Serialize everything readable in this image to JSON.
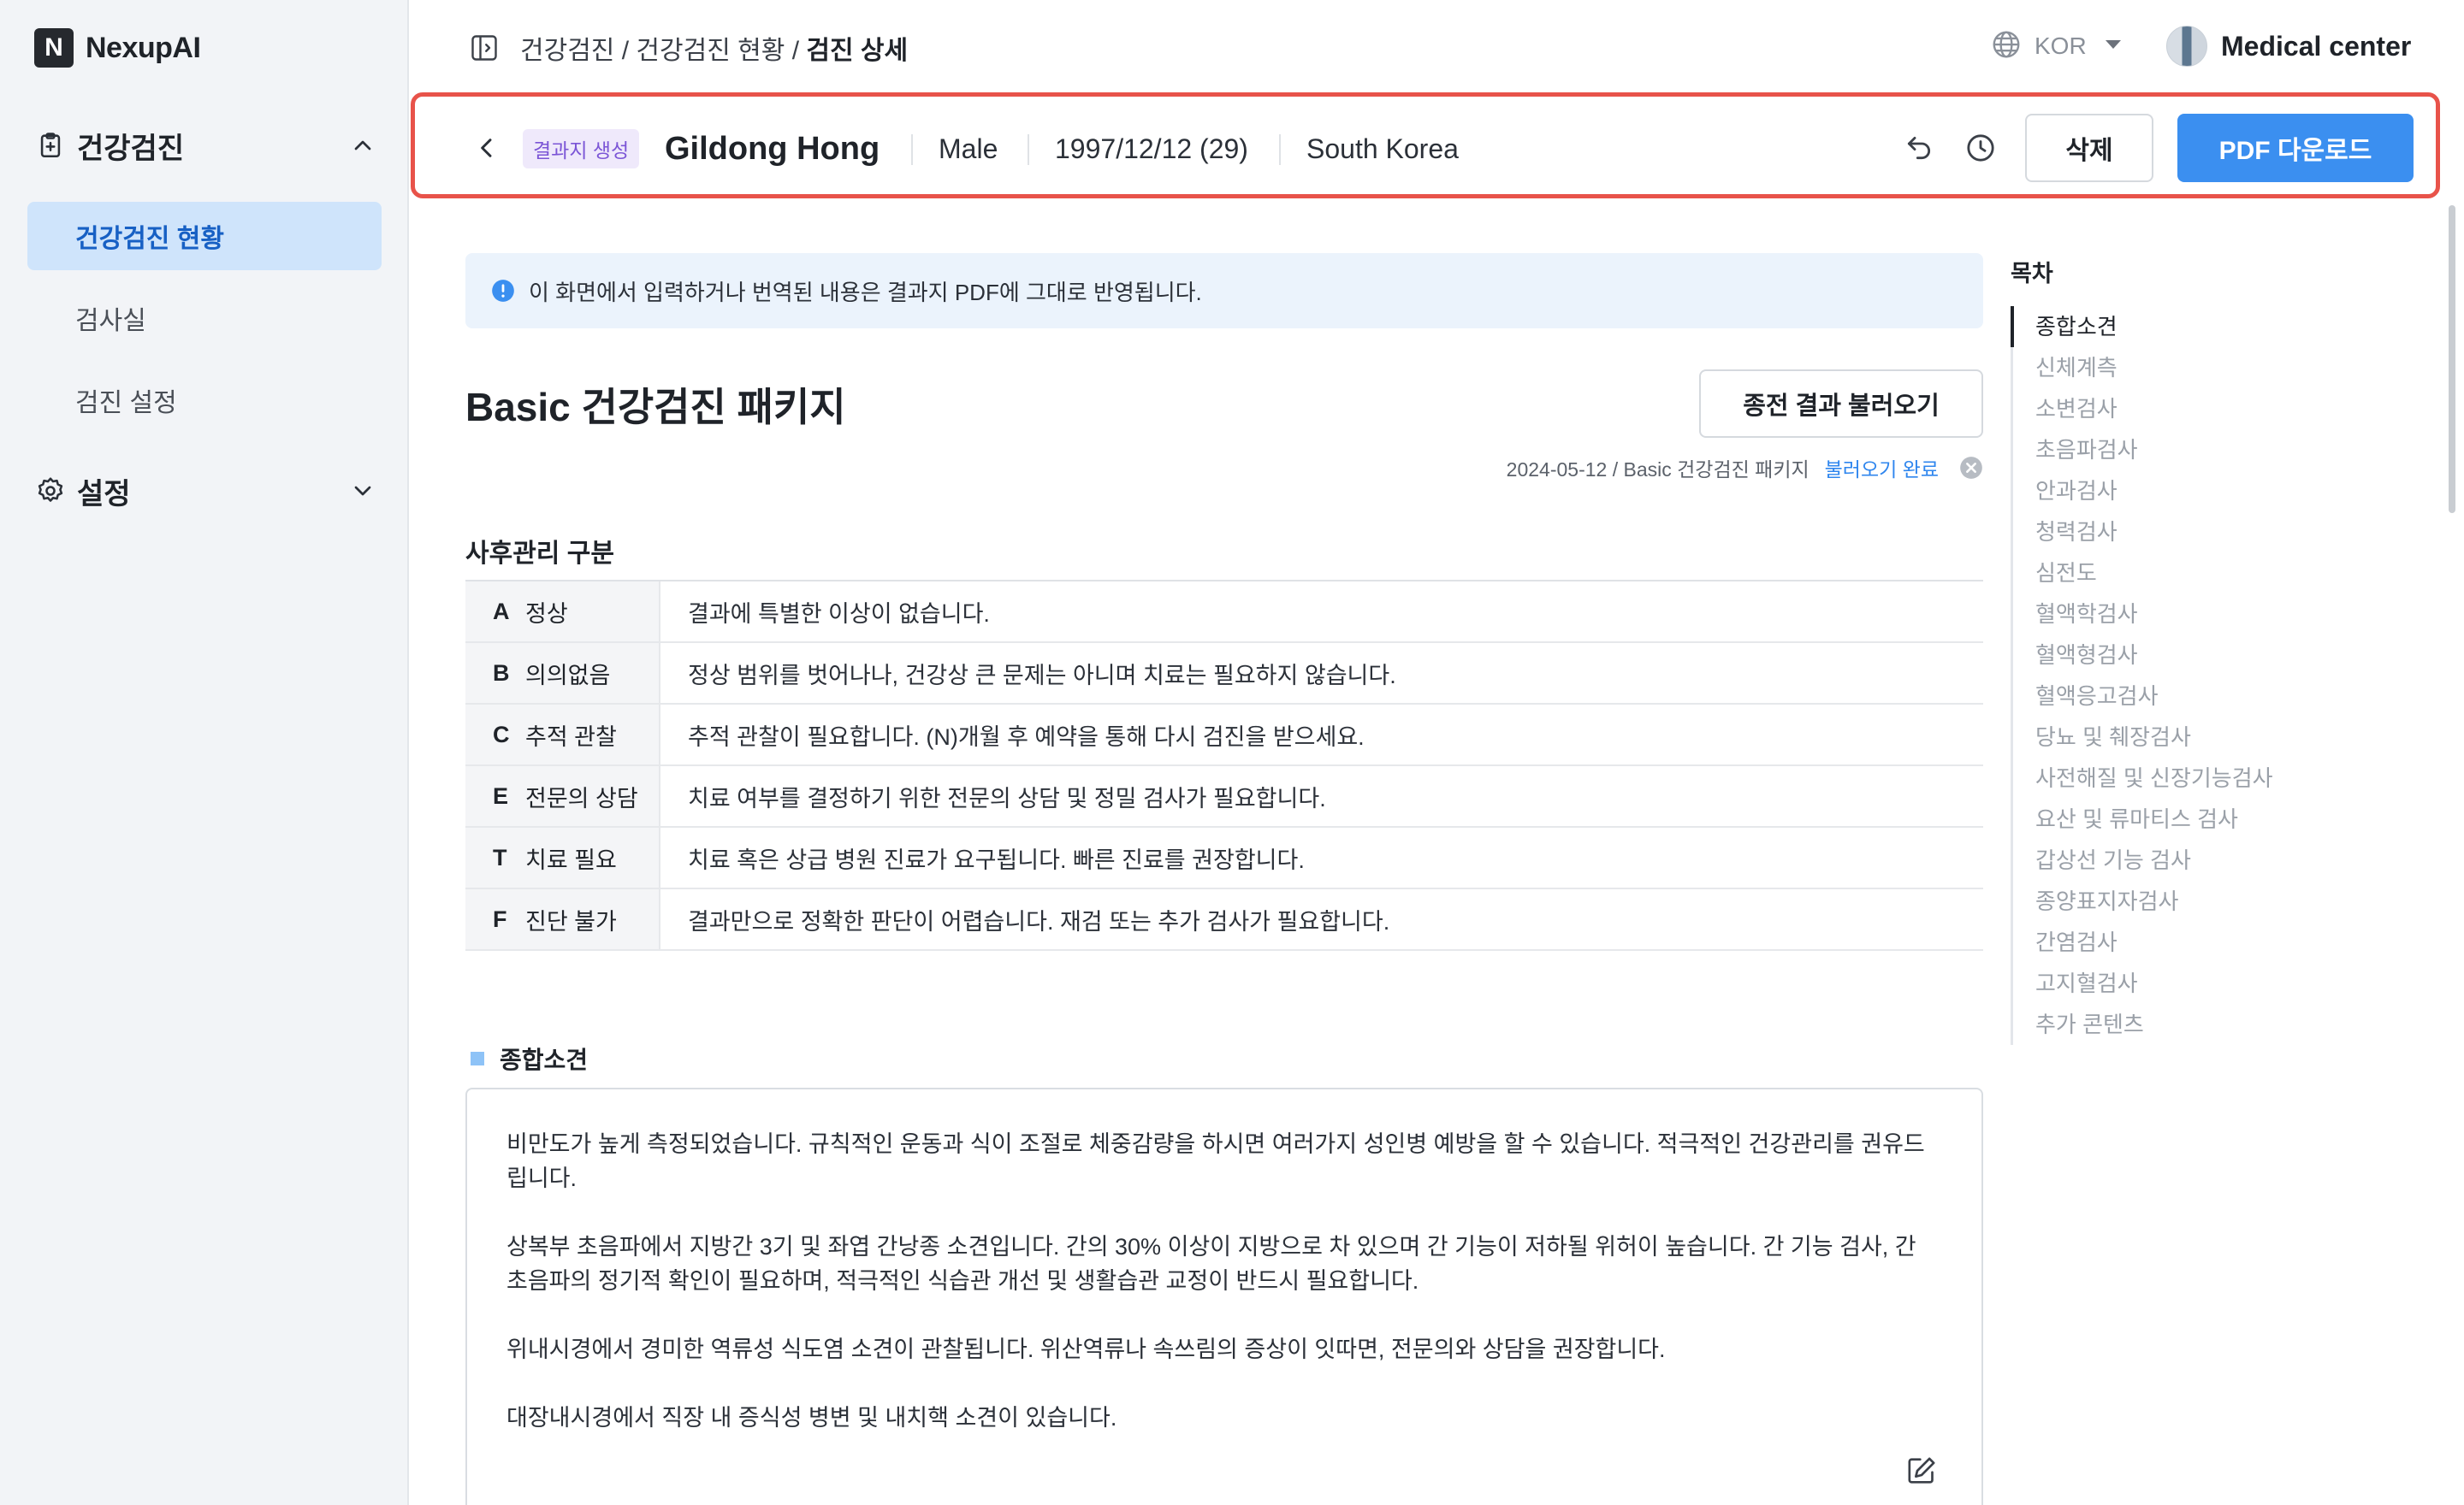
{
  "app": {
    "logo_letter": "N",
    "name": "NexupAI"
  },
  "sidebar": {
    "groups": [
      {
        "label": "건강검진",
        "icon": "clipboard-icon",
        "expanded": true
      },
      {
        "label": "설정",
        "icon": "gear-icon",
        "expanded": false
      }
    ],
    "items": [
      {
        "label": "건강검진 현황",
        "active": true
      },
      {
        "label": "검사실",
        "active": false
      },
      {
        "label": "검진 설정",
        "active": false
      }
    ]
  },
  "topbar": {
    "breadcrumb": {
      "part1": "건강검진",
      "sep": " / ",
      "part2": "건강검진 현황",
      "current": "검진 상세"
    },
    "language": "KOR",
    "user": "Medical center"
  },
  "patient": {
    "badge": "결과지 생성",
    "name": "Gildong Hong",
    "sex": "Male",
    "birth": "1997/12/12 (29)",
    "country": "South Korea",
    "delete_label": "삭제",
    "pdf_label": "PDF 다운로드"
  },
  "notice": "이 화면에서 입력하거나 번역된 내용은 결과지 PDF에 그대로 반영됩니다.",
  "package": {
    "title": "Basic 건강검진 패키지",
    "load_button": "종전 결과 불러오기",
    "load_info": "2024-05-12 / Basic 건강검진 패키지",
    "load_status": "불러오기 완료"
  },
  "grades": {
    "title": "사후관리 구분",
    "rows": [
      {
        "letter": "A",
        "name": "정상",
        "desc": "결과에 특별한 이상이 없습니다."
      },
      {
        "letter": "B",
        "name": "의의없음",
        "desc": "정상 범위를 벗어나나, 건강상 큰 문제는 아니며 치료는 필요하지 않습니다."
      },
      {
        "letter": "C",
        "name": "추적 관찰",
        "desc": "추적 관찰이 필요합니다. (N)개월 후 예약을 통해 다시 검진을 받으세요."
      },
      {
        "letter": "E",
        "name": "전문의 상담",
        "desc": "치료 여부를 결정하기 위한 전문의 상담 및 정밀 검사가 필요합니다."
      },
      {
        "letter": "T",
        "name": "치료 필요",
        "desc": "치료 혹은 상급 병원 진료가 요구됩니다. 빠른 진료를 권장합니다."
      },
      {
        "letter": "F",
        "name": "진단 불가",
        "desc": "결과만으로 정확한 판단이 어렵습니다. 재검 또는 추가 검사가 필요합니다."
      }
    ]
  },
  "summary": {
    "title": "종합소견",
    "paragraphs": [
      "비만도가 높게 측정되었습니다. 규칙적인 운동과 식이 조절로 체중감량을 하시면 여러가지 성인병 예방을 할 수 있습니다. 적극적인 건강관리를 권유드립니다.",
      "상복부 초음파에서 지방간 3기 및 좌엽 간낭종 소견입니다. 간의 30% 이상이 지방으로 차 있으며 간 기능이 저하될 위허이 높습니다. 간 기능 검사, 간 초음파의 정기적 확인이 필요하며, 적극적인 식습관 개선 및 생활습관 교정이 반드시 필요합니다.",
      "위내시경에서 경미한 역류성 식도염 소견이 관찰됩니다. 위산역류나 속쓰림의 증상이 잇따면, 전문의와 상담을 권장합니다.",
      "대장내시경에서 직장 내 증식성 병변 및 내치핵 소견이 있습니다."
    ]
  },
  "toc": {
    "title": "목차",
    "items": [
      "종합소견",
      "신체계측",
      "소변검사",
      "초음파검사",
      "안과검사",
      "청력검사",
      "심전도",
      "혈액학검사",
      "혈액형검사",
      "혈액응고검사",
      "당뇨 및 췌장검사",
      "사전해질 및 신장기능검사",
      "요산 및 류마티스 검사",
      "갑상선 기능 검사",
      "종양표지자검사",
      "간염검사",
      "고지혈검사",
      "추가 콘텐츠"
    ],
    "active_index": 0
  },
  "colors": {
    "accent": "#3b8ff0",
    "highlight_border": "#e8534a",
    "badge": "#7b55d6"
  }
}
